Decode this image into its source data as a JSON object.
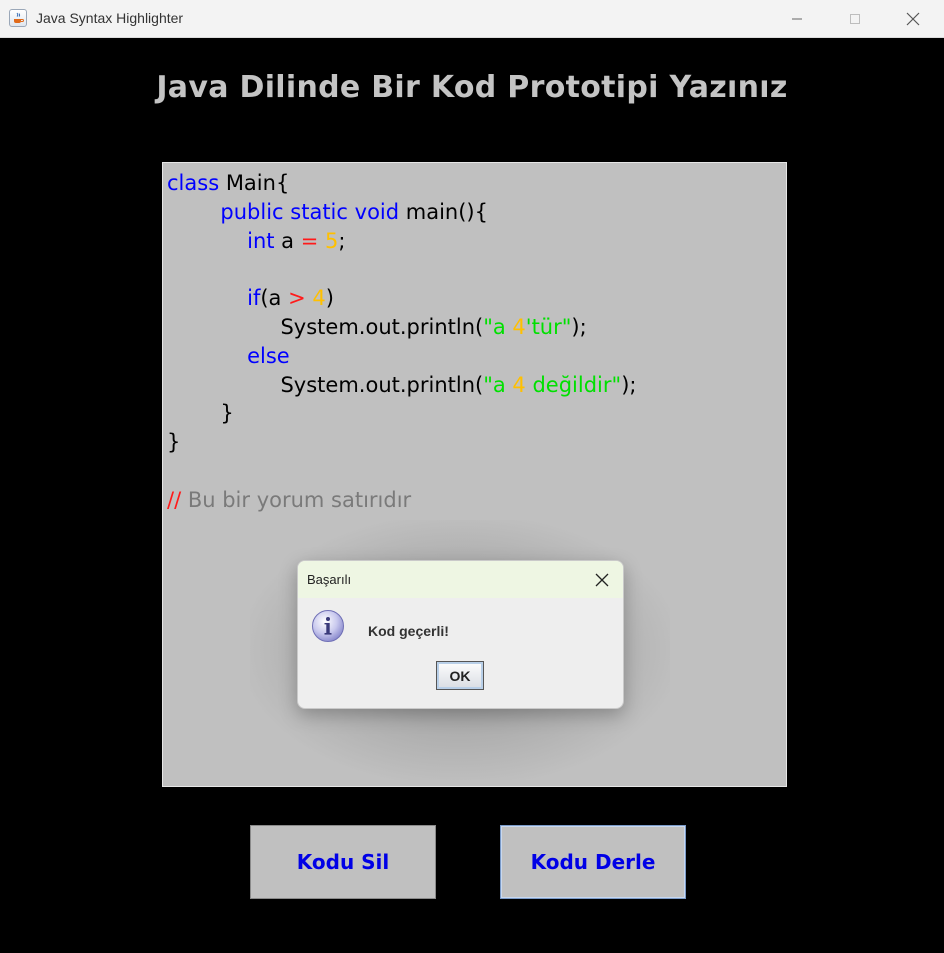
{
  "window": {
    "title": "Java Syntax Highlighter"
  },
  "heading": "Java Dilinde Bir Kod Prototipi Yazınız",
  "editor": {
    "lines": [
      [
        {
          "t": "class",
          "c": "kw"
        },
        {
          "t": " Main{"
        }
      ],
      [
        {
          "t": "        "
        },
        {
          "t": "public",
          "c": "kw"
        },
        {
          "t": " "
        },
        {
          "t": "static",
          "c": "kw"
        },
        {
          "t": " "
        },
        {
          "t": "void",
          "c": "kw"
        },
        {
          "t": " main(){"
        }
      ],
      [
        {
          "t": "            "
        },
        {
          "t": "int",
          "c": "kw"
        },
        {
          "t": " a "
        },
        {
          "t": "=",
          "c": "op"
        },
        {
          "t": " "
        },
        {
          "t": "5",
          "c": "num"
        },
        {
          "t": ";"
        }
      ],
      [],
      [
        {
          "t": "            "
        },
        {
          "t": "if",
          "c": "kw"
        },
        {
          "t": "(a "
        },
        {
          "t": ">",
          "c": "op"
        },
        {
          "t": " "
        },
        {
          "t": "4",
          "c": "num"
        },
        {
          "t": ")"
        }
      ],
      [
        {
          "t": "                 System.out.println("
        },
        {
          "t": "\"a ",
          "c": "str"
        },
        {
          "t": "4",
          "c": "num"
        },
        {
          "t": "'tür\"",
          "c": "str"
        },
        {
          "t": ");"
        }
      ],
      [
        {
          "t": "            "
        },
        {
          "t": "else",
          "c": "kw"
        }
      ],
      [
        {
          "t": "                 System.out.println("
        },
        {
          "t": "\"a ",
          "c": "str"
        },
        {
          "t": "4",
          "c": "num"
        },
        {
          "t": " değildir\"",
          "c": "str"
        },
        {
          "t": ");"
        }
      ],
      [
        {
          "t": "        }"
        }
      ],
      [
        {
          "t": "}"
        }
      ],
      [],
      [
        {
          "t": "//",
          "c": "op"
        },
        {
          "t": " Bu bir yorum satırıdır",
          "c": "cm"
        }
      ]
    ]
  },
  "dialog": {
    "title": "Başarılı",
    "message": "Kod geçerli!",
    "ok_label": "OK",
    "icon": "info-icon"
  },
  "buttons": {
    "clear_label": "Kodu Sil",
    "compile_label": "Kodu Derle"
  },
  "colors": {
    "keyword": "#0000ff",
    "operator": "#ff1a1a",
    "number": "#ffc000",
    "string": "#00e000",
    "comment": "#7a7a7a",
    "button_text": "#0000e6"
  }
}
